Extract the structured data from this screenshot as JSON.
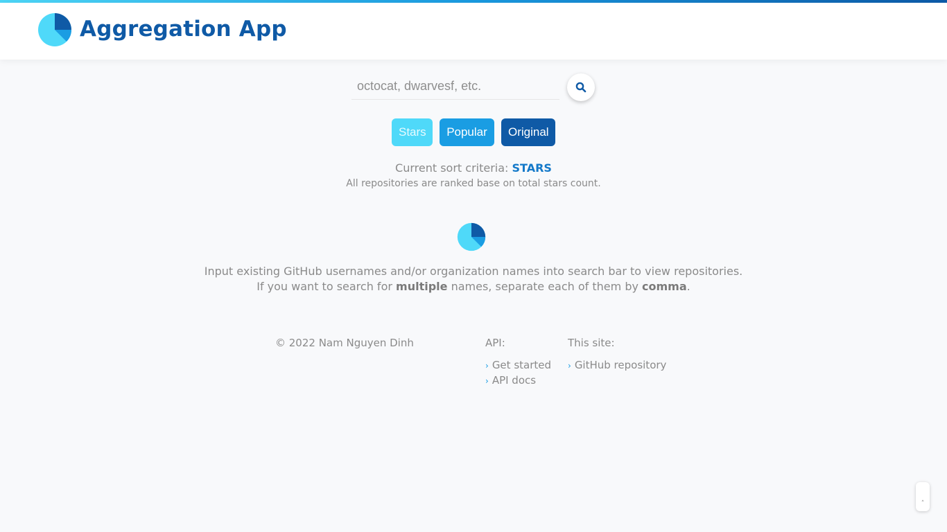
{
  "app": {
    "title": "Aggregation App",
    "logo_icon": "pie-chart-icon"
  },
  "search": {
    "placeholder": "octocat, dwarvesf, etc.",
    "value": "",
    "icon": "search-icon"
  },
  "sort": {
    "buttons": [
      {
        "label": "Stars",
        "color": "#4fd9f9"
      },
      {
        "label": "Popular",
        "color": "#1a9de3"
      },
      {
        "label": "Original",
        "color": "#0f5aa6"
      }
    ],
    "criteria_label": "Current sort criteria:",
    "criteria_value": "STARS",
    "description": "All repositories are ranked base on total stars count."
  },
  "instructions": {
    "line1": "Input existing GitHub usernames and/or organization names into search bar to view repositories.",
    "line2_pre": "If you want to search for",
    "line2_b1": "multiple",
    "line2_mid": "names, separate each of them by",
    "line2_b2": "comma",
    "line2_end": "."
  },
  "footer": {
    "copyright": "© 2022 Nam Nguyen Dinh",
    "api": {
      "title": "API:",
      "links": [
        "Get started",
        "API docs"
      ]
    },
    "site": {
      "title": "This site:",
      "links": [
        "GitHub repository"
      ]
    }
  },
  "scroll_top": {
    "icon": "chevron-up-icon",
    "glyph": "˄"
  },
  "colors": {
    "brand_dark": "#0f5aa6",
    "brand_mid": "#1a9de3",
    "brand_light": "#4fd9f9"
  }
}
